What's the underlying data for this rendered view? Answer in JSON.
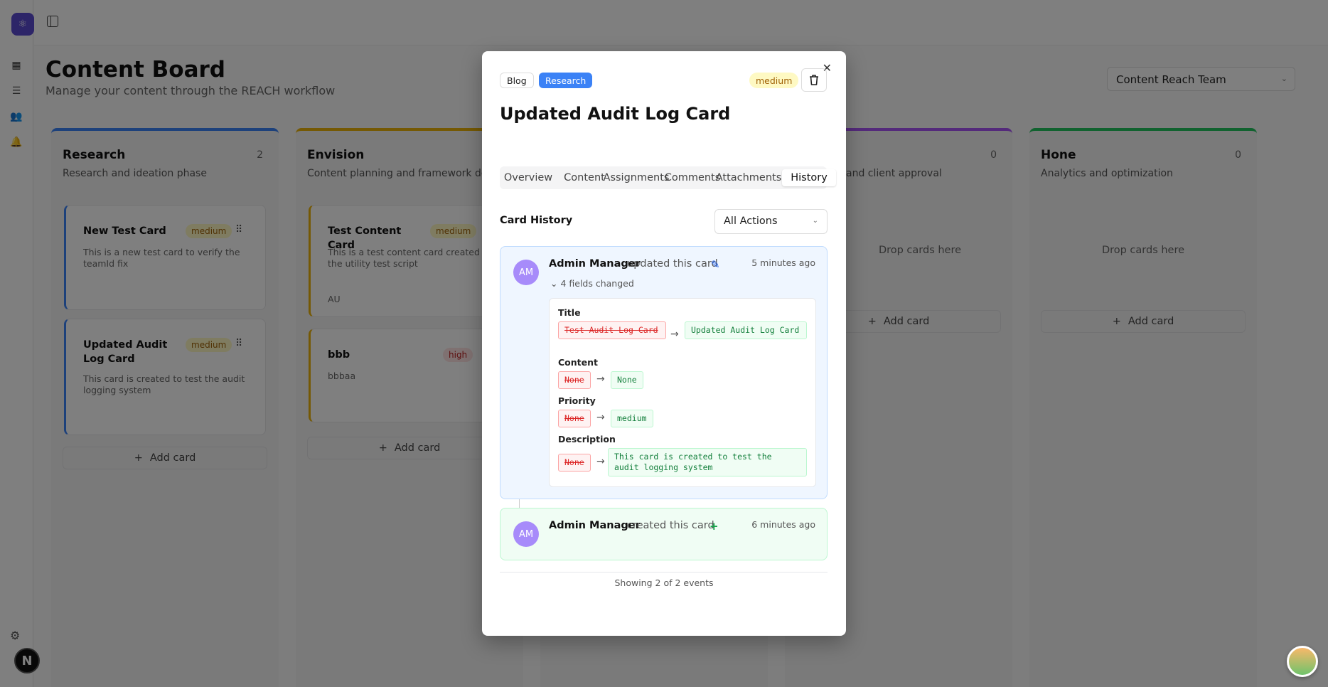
{
  "page": {
    "title": "Content Board",
    "subtitle": "Manage your content through the REACH workflow"
  },
  "team_select": {
    "value": "Content Reach Team"
  },
  "columns": [
    {
      "title": "Research",
      "desc": "Research and ideation phase",
      "count": "2",
      "color": "#3b82f6"
    },
    {
      "title": "Envision",
      "desc": "Content planning and framework design",
      "count": "",
      "color": "#eab308"
    },
    {
      "title": "",
      "desc": "",
      "count": "",
      "color": "#f97316"
    },
    {
      "title": "",
      "desc": "and client approval",
      "count": "0",
      "color": "#a855f7"
    },
    {
      "title": "Hone",
      "desc": "Analytics and optimization",
      "count": "0",
      "color": "#22c55e"
    }
  ],
  "cards": {
    "c1": {
      "title": "New Test Card",
      "priority": "medium",
      "desc": "This is a new test card to verify the teamId fix"
    },
    "c2": {
      "title": "Updated Audit Log Card",
      "priority": "medium",
      "desc": "This card is created to test the audit logging system"
    },
    "c3": {
      "title": "Test Content Card",
      "priority": "medium",
      "desc": "This is a test content card created by the utility test script",
      "assignee": "AU"
    },
    "c4": {
      "title": "bbb",
      "priority": "high",
      "desc": "bbbaa"
    }
  },
  "board": {
    "add_card": "Add card",
    "drop_here": "Drop cards here"
  },
  "modal": {
    "tags": [
      "Blog",
      "Research"
    ],
    "priority": "medium",
    "title": "Updated Audit Log Card",
    "tabs": [
      "Overview",
      "Content",
      "Assignments",
      "Comments",
      "Attachments",
      "History"
    ],
    "active_tab": "History",
    "history_label": "Card History",
    "filter": "All Actions",
    "events": [
      {
        "initials": "AM",
        "actor": "Admin Manager",
        "verb": "updated this card",
        "time": "5 minutes ago",
        "fields_changed": "4 fields changed",
        "changes": [
          {
            "field": "Title",
            "old": "Test Audit Log Card",
            "new": "Updated Audit Log Card"
          },
          {
            "field": "Content",
            "old": "None",
            "new": "None"
          },
          {
            "field": "Priority",
            "old": "None",
            "new": "medium"
          },
          {
            "field": "Description",
            "old": "None",
            "new": "This card is created to test the audit logging system"
          }
        ]
      },
      {
        "initials": "AM",
        "actor": "Admin Manager",
        "verb": "created this card",
        "time": "6 minutes ago"
      }
    ],
    "footer": "Showing 2 of 2 events"
  },
  "misc": {
    "user_badge": "N",
    "sidebar_initial": "A"
  }
}
